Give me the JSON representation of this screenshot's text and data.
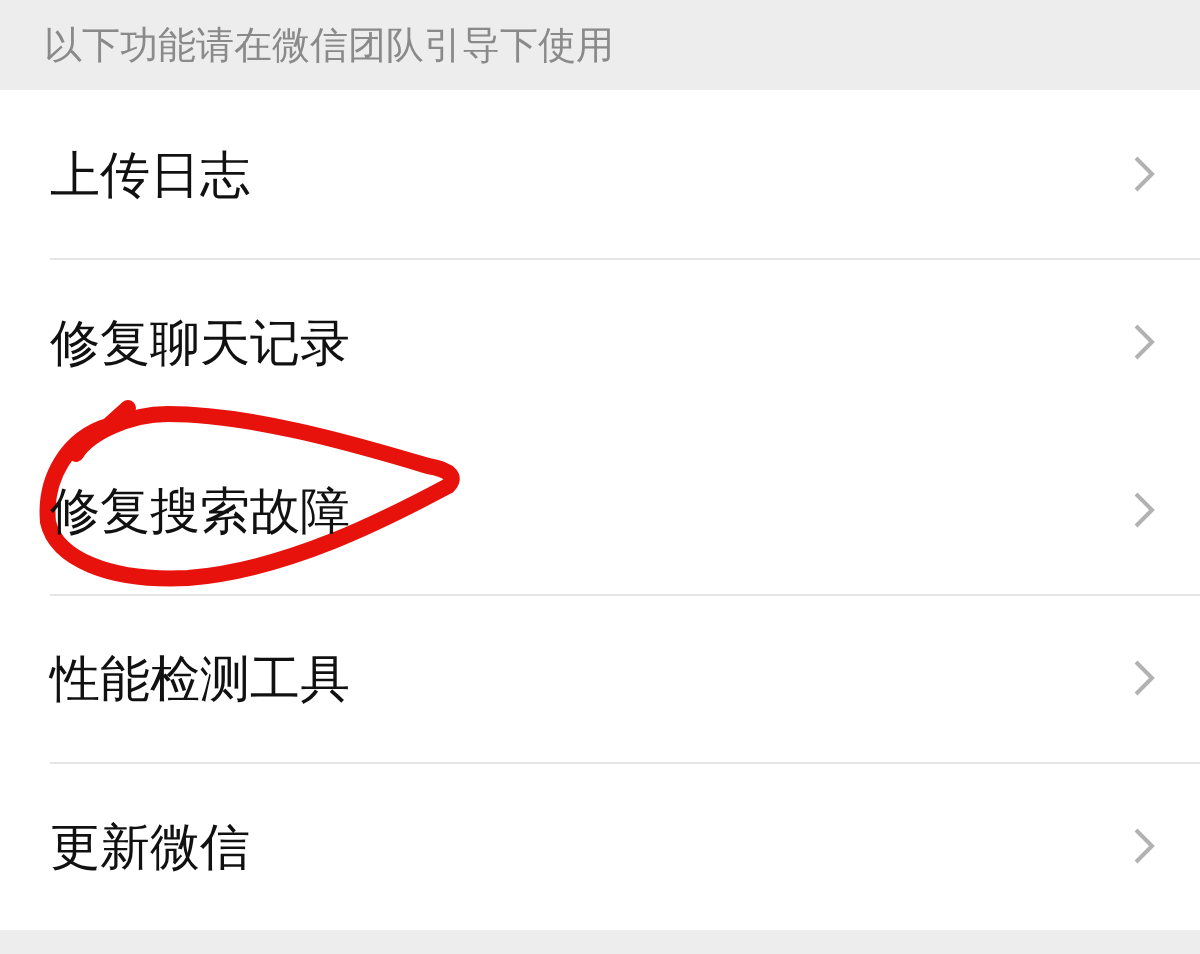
{
  "section_header": "以下功能请在微信团队引导下使用",
  "items": [
    {
      "label": "上传日志",
      "circled": false
    },
    {
      "label": "修复聊天记录",
      "circled": false
    },
    {
      "label": "修复搜索故障",
      "circled": true
    },
    {
      "label": "性能检测工具",
      "circled": false
    },
    {
      "label": "更新微信",
      "circled": false
    }
  ]
}
